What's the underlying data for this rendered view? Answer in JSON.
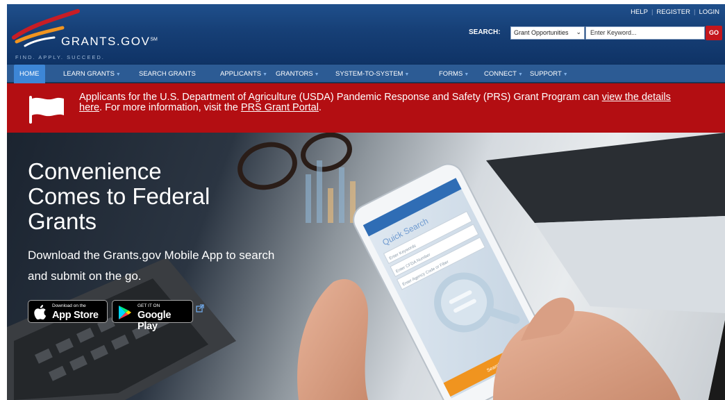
{
  "header": {
    "logo_text": "GRANTS.GOV",
    "logo_sm": "SM",
    "tagline": "FIND. APPLY. SUCCEED.",
    "top_links": [
      "HELP",
      "REGISTER",
      "LOGIN"
    ],
    "search": {
      "label": "SEARCH:",
      "select_value": "Grant Opportunities",
      "placeholder": "Enter Keyword...",
      "go_label": "GO"
    }
  },
  "nav": {
    "items": [
      {
        "label": "HOME",
        "dropdown": false,
        "active": true
      },
      {
        "label": "LEARN GRANTS",
        "dropdown": true,
        "active": false
      },
      {
        "label": "SEARCH GRANTS",
        "dropdown": false,
        "active": false
      },
      {
        "label": "APPLICANTS",
        "dropdown": true,
        "active": false
      },
      {
        "label": "GRANTORS",
        "dropdown": true,
        "active": false
      },
      {
        "label": "SYSTEM-TO-SYSTEM",
        "dropdown": true,
        "active": false
      },
      {
        "label": "FORMS",
        "dropdown": true,
        "active": false
      },
      {
        "label": "CONNECT",
        "dropdown": true,
        "active": false
      },
      {
        "label": "SUPPORT",
        "dropdown": true,
        "active": false
      }
    ]
  },
  "alert": {
    "text_before": "Applicants for the U.S. Department of Agriculture (USDA) Pandemic Response and Safety (PRS) Grant Program can ",
    "link1": "view the details here",
    "text_middle": ". For more information, visit the ",
    "link2": "PRS Grant Portal",
    "text_after": "."
  },
  "hero": {
    "title_lines": [
      "Convenience",
      "Comes to Federal",
      "Grants"
    ],
    "subtitle": "Download the Grants.gov Mobile App to search and submit on the go.",
    "app_store": {
      "small": "Download on the",
      "big": "App Store"
    },
    "google_play": {
      "small": "GET IT ON",
      "big": "Google Play"
    },
    "phone": {
      "heading": "Quick Search",
      "fields": [
        "Enter Keywords",
        "Enter CFDA Number",
        "Enter Agency Code or Filter"
      ],
      "button": "Search"
    }
  },
  "colors": {
    "header_blue": "#163f76",
    "nav_blue": "#2c5b94",
    "active_tab": "#3d86d6",
    "alert_red": "#b30e12",
    "go_red": "#c4161c",
    "phone_button": "#f0941f"
  }
}
